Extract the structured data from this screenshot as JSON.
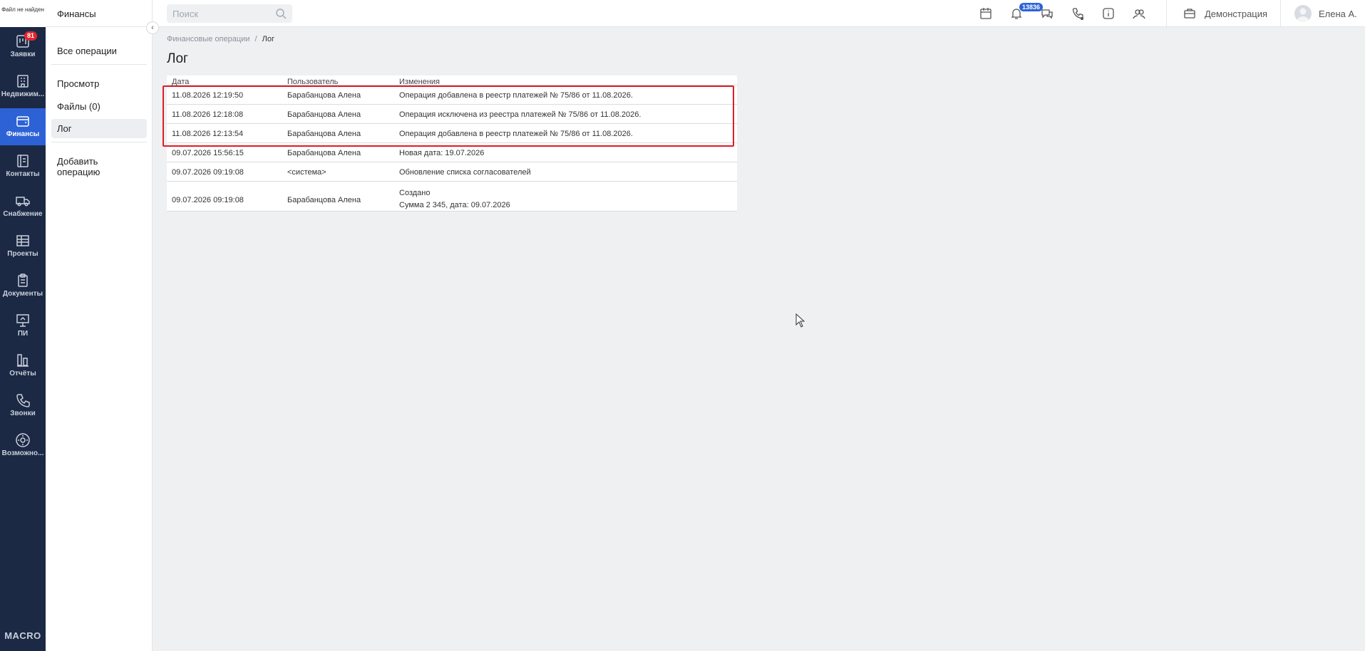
{
  "rail": {
    "logo_text": "Файл не найден",
    "items": [
      {
        "label": "Заявки",
        "icon": "requests-icon",
        "badge": "81"
      },
      {
        "label": "Недвижим...",
        "icon": "building-icon"
      },
      {
        "label": "Финансы",
        "icon": "wallet-icon",
        "active": true
      },
      {
        "label": "Контакты",
        "icon": "contacts-icon"
      },
      {
        "label": "Снабжение",
        "icon": "truck-icon"
      },
      {
        "label": "Проекты",
        "icon": "projects-icon"
      },
      {
        "label": "Документы",
        "icon": "clipboard-icon"
      },
      {
        "label": "ПИ",
        "icon": "presentation-icon"
      },
      {
        "label": "Отчёты",
        "icon": "reports-icon"
      },
      {
        "label": "Звонки",
        "icon": "phone-icon"
      },
      {
        "label": "Возможно...",
        "icon": "gear-icon"
      }
    ],
    "brand": "MACRO"
  },
  "sidebar": {
    "title": "Финансы",
    "all_ops": "Все операции",
    "view": "Просмотр",
    "files": "Файлы (0)",
    "log": "Лог",
    "add": "Добавить операцию"
  },
  "topbar": {
    "search_placeholder": "Поиск",
    "notifications_count": "13836",
    "demo_label": "Демонстрация",
    "user_name": "Елена А."
  },
  "breadcrumb": {
    "parent": "Финансовые операции",
    "separator": "/",
    "current": "Лог"
  },
  "page_title": "Лог",
  "log": {
    "columns": [
      "Дата",
      "Пользователь",
      "Изменения"
    ],
    "rows": [
      {
        "date": "11.08.2026 12:19:50",
        "user": "Барабанцова Алена",
        "change": "Операция добавлена в реестр платежей № 75/86 от 11.08.2026."
      },
      {
        "date": "11.08.2026 12:18:08",
        "user": "Барабанцова Алена",
        "change": "Операция исключена из реестра платежей № 75/86 от 11.08.2026."
      },
      {
        "date": "11.08.2026 12:13:54",
        "user": "Барабанцова Алена",
        "change": "Операция добавлена в реестр платежей № 75/86 от 11.08.2026."
      },
      {
        "date": "09.07.2026 15:56:15",
        "user": "Барабанцова Алена",
        "change": "Новая дата: 19.07.2026"
      },
      {
        "date": "09.07.2026 09:19:08",
        "user": "<система>",
        "change": "Обновление списка согласователей"
      },
      {
        "date": "09.07.2026 09:19:08",
        "user": "Барабанцова Алена",
        "change_line1": "Создано",
        "change_line2": "Сумма 2 345, дата: 09.07.2026"
      }
    ]
  },
  "colors": {
    "rail_bg": "#1c2945",
    "active_blue": "#2d62d6",
    "highlight_red": "#e01b24",
    "badge_red": "#e0262d"
  }
}
